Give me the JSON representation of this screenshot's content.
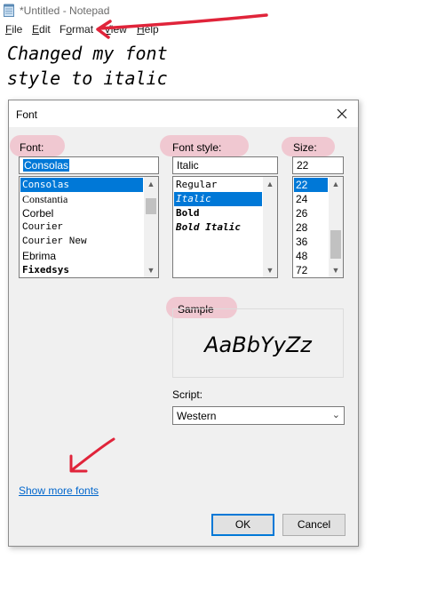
{
  "notepad": {
    "title": "*Untitled - Notepad",
    "menu": [
      {
        "label": "File",
        "mnemonic": "F",
        "rest": "ile"
      },
      {
        "label": "Edit",
        "mnemonic": "E",
        "rest": "dit"
      },
      {
        "label": "Format",
        "mnemonic": "o",
        "pre": "F",
        "rest": "rmat"
      },
      {
        "label": "View",
        "mnemonic": "V",
        "rest": "iew"
      },
      {
        "label": "Help",
        "mnemonic": "H",
        "rest": "elp"
      }
    ],
    "editor_text": "Changed my font\nstyle to italic"
  },
  "dialog": {
    "title": "Font",
    "font": {
      "label": "Font:",
      "value": "Consolas",
      "items": [
        "Consolas",
        "Constantia",
        "Corbel",
        "Courier",
        "Courier New",
        "Ebrima",
        "Fixedsys"
      ],
      "selected": "Consolas"
    },
    "style": {
      "label": "Font style:",
      "value": "Italic",
      "items": [
        "Regular",
        "Italic",
        "Bold",
        "Bold Italic"
      ],
      "selected": "Italic"
    },
    "size": {
      "label": "Size:",
      "value": "22",
      "items": [
        "22",
        "24",
        "26",
        "28",
        "36",
        "48",
        "72"
      ],
      "selected": "22"
    },
    "sample": {
      "label": "Sample",
      "text": "AaBbYyZz"
    },
    "script": {
      "label": "Script:",
      "value": "Western"
    },
    "show_more": "Show more fonts",
    "ok": "OK",
    "cancel": "Cancel"
  },
  "colors": {
    "selection": "#0078d7",
    "annotation_red": "#e0243a",
    "annotation_highlight": "#f096aa",
    "link": "#0066cc"
  }
}
